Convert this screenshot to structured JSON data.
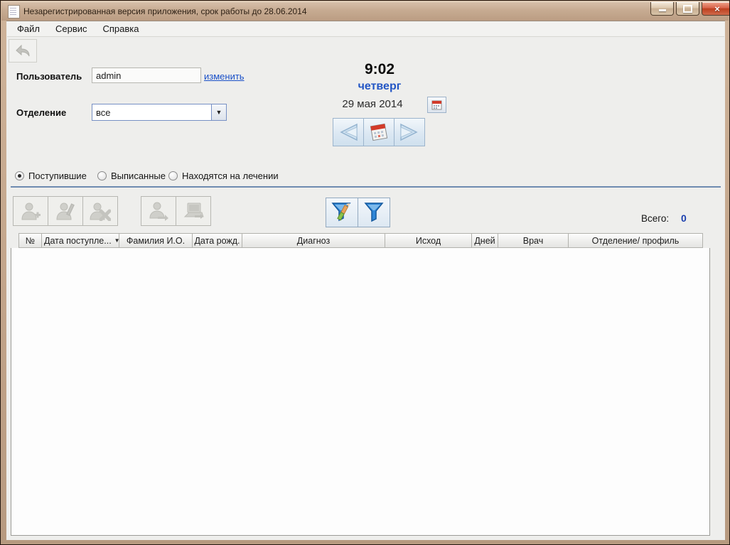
{
  "window": {
    "title": "Незарегистрированная версия приложения, срок работы до 28.06.2014"
  },
  "menu": {
    "items": [
      "Файл",
      "Сервис",
      "Справка"
    ]
  },
  "user_panel": {
    "user_label": "Пользователь",
    "user_value": "admin",
    "change_link": "изменить",
    "department_label": "Отделение",
    "department_value": "все"
  },
  "clock": {
    "time": "9:02",
    "weekday": "четверг",
    "date": "29 мая 2014"
  },
  "patient_filter": {
    "options": [
      {
        "label": "Поступившие",
        "selected": true
      },
      {
        "label": "Выписанные",
        "selected": false
      },
      {
        "label": "Находятся на лечении",
        "selected": false
      }
    ]
  },
  "summary": {
    "label": "Всего:",
    "value": "0"
  },
  "table": {
    "columns": [
      {
        "label": "№"
      },
      {
        "label": "Дата поступле...",
        "sorted": "desc"
      },
      {
        "label": "Фамилия И.О."
      },
      {
        "label": "Дата рожд."
      },
      {
        "label": "Диагноз"
      },
      {
        "label": "Исход"
      },
      {
        "label": "Дней"
      },
      {
        "label": "Врач"
      },
      {
        "label": "Отделение/ профиль"
      }
    ],
    "rows": []
  },
  "icons": {
    "close": "×",
    "combo_arrow": "▼",
    "sort_desc": "▼"
  },
  "colors": {
    "titlebar": "#c7ab92",
    "weekday_blue": "#2356c5",
    "link_blue": "#1a50c8",
    "total_blue": "#1b3fae",
    "divider_blue": "#6e8bb0",
    "funnel_blue": "#2e86d8"
  }
}
